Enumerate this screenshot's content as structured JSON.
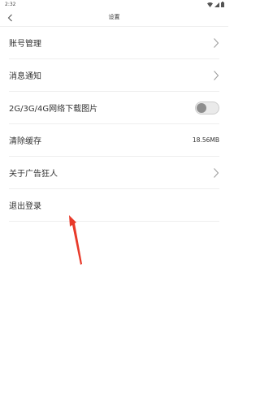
{
  "status_bar": {
    "time": "2:32",
    "icons": [
      "wifi-icon",
      "cellular-signal-icon",
      "battery-icon"
    ]
  },
  "nav": {
    "title": "设置",
    "back_icon": "chevron-left-icon"
  },
  "settings": {
    "items": [
      {
        "label": "账号管理",
        "trailing": "chevron"
      },
      {
        "label": "消息通知",
        "trailing": "chevron"
      },
      {
        "label": "2G/3G/4G网络下载图片",
        "trailing": "toggle",
        "toggle_on": false
      },
      {
        "label": "清除缓存",
        "trailing": "value",
        "value": "18.56MB"
      },
      {
        "label": "关于广告狂人",
        "trailing": "chevron"
      },
      {
        "label": "退出登录",
        "trailing": "none"
      }
    ]
  },
  "annotation": {
    "arrow_color": "#e83a2a",
    "icon": "red-arrow-icon"
  }
}
